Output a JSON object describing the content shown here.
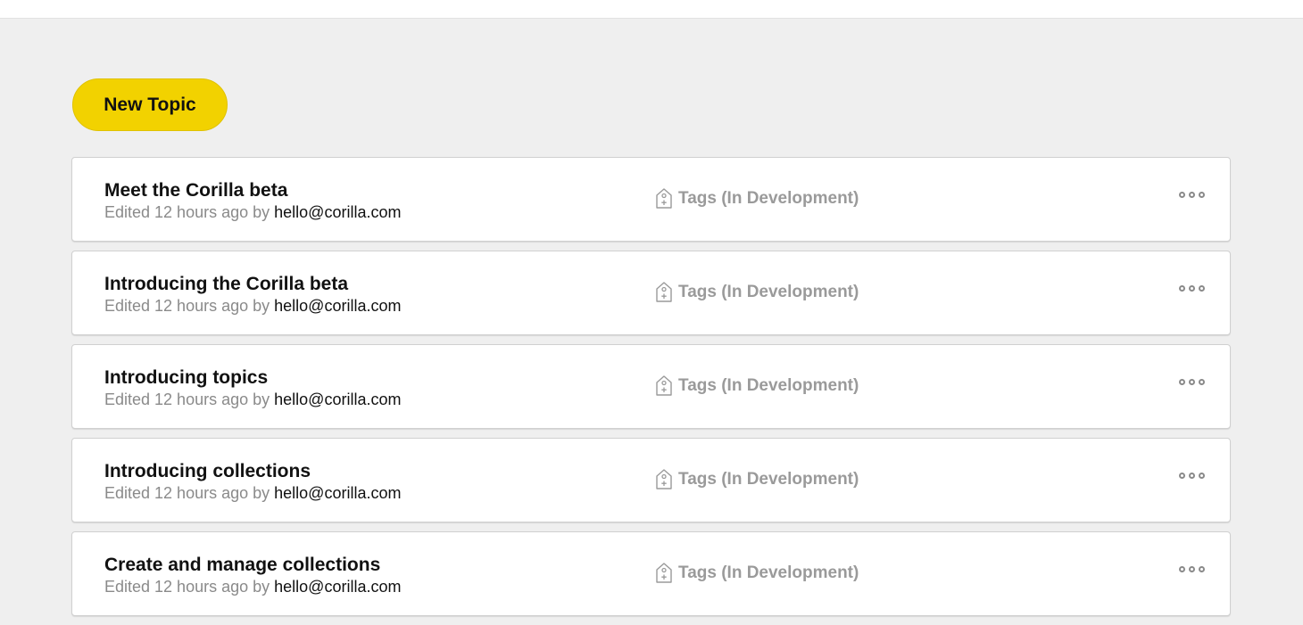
{
  "header": {},
  "actions": {
    "new_topic_label": "New Topic"
  },
  "topics": [
    {
      "title": "Meet the Corilla beta",
      "edited_prefix": "Edited 12 hours ago by ",
      "author": "hello@corilla.com",
      "tags_label": "Tags (In Development)"
    },
    {
      "title": "Introducing the Corilla beta",
      "edited_prefix": "Edited 12 hours ago by ",
      "author": "hello@corilla.com",
      "tags_label": "Tags (In Development)"
    },
    {
      "title": "Introducing topics",
      "edited_prefix": "Edited 12 hours ago by ",
      "author": "hello@corilla.com",
      "tags_label": "Tags (In Development)"
    },
    {
      "title": "Introducing collections",
      "edited_prefix": "Edited 12 hours ago by ",
      "author": "hello@corilla.com",
      "tags_label": "Tags (In Development)"
    },
    {
      "title": "Create and manage collections",
      "edited_prefix": "Edited 12 hours ago by ",
      "author": "hello@corilla.com",
      "tags_label": "Tags (In Development)"
    }
  ],
  "icons": {
    "tag": "tag-add-icon",
    "more": "more-options-icon"
  },
  "colors": {
    "accent": "#f2d200",
    "background": "#efefef",
    "card": "#ffffff",
    "muted_text": "#8a8a8a"
  }
}
